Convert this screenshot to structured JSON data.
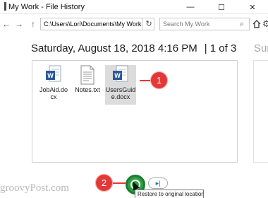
{
  "window": {
    "title": "My Work - File History",
    "minimize_glyph": "—",
    "maximize_glyph": "☐",
    "close_glyph": "✕"
  },
  "navbar": {
    "back_glyph": "←",
    "forward_glyph": "→",
    "up_glyph": "↑",
    "address": "C:\\Users\\Lori\\Documents\\My Work",
    "refresh_glyph": "↻",
    "search_placeholder": "Search My Work",
    "search_glyph": "⌕",
    "settings_glyph": "⚙"
  },
  "snapshot": {
    "datetime": "Saturday, August 18, 2018 4:16 PM",
    "position": "|  1 of 3",
    "next_label": "Sunc"
  },
  "files": [
    {
      "name": "JobAid.docx",
      "type": "word"
    },
    {
      "name": "Notes.txt",
      "type": "text"
    },
    {
      "name": "UsersGuide.docx",
      "type": "word",
      "selected": true
    }
  ],
  "callouts": [
    {
      "label": "1"
    },
    {
      "label": "2"
    }
  ],
  "controls": {
    "next_glyph": "▸|",
    "tooltip": "Restore to original location."
  },
  "watermark": "groovyPost.com",
  "colors": {
    "callout": "#e23838",
    "restore_green": "#2ea043",
    "word_blue": "#2b579a"
  }
}
